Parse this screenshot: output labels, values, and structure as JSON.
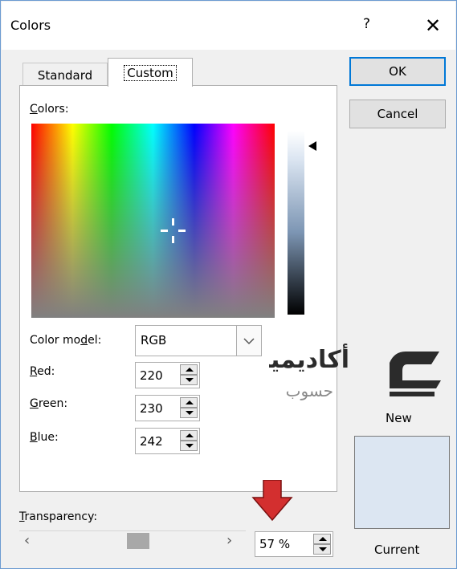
{
  "window": {
    "title": "Colors",
    "help": "?",
    "close": "✕"
  },
  "tabs": {
    "standard": "Standard",
    "custom": "Custom"
  },
  "colors_label": {
    "u": "C",
    "rest": "olors:"
  },
  "color_model": {
    "pre": "Color mo",
    "u": "d",
    "post": "el:",
    "value": "RGB"
  },
  "red": {
    "u": "R",
    "rest": "ed:",
    "value": "220"
  },
  "green": {
    "u": "G",
    "rest": "reen:",
    "value": "230"
  },
  "blue": {
    "u": "B",
    "rest": "lue:",
    "value": "242"
  },
  "transparency": {
    "u": "T",
    "rest": "ransparency:",
    "value": "57 %",
    "level": 0.57
  },
  "buttons": {
    "ok": "OK",
    "cancel": "Cancel"
  },
  "preview": {
    "new_label": "New",
    "current_label": "Current",
    "color": "#dce6f2"
  },
  "watermark": {
    "line1": "أكاديمية",
    "line2": "حسوب"
  },
  "accent": {
    "focus_border": "#0078d7",
    "annotation_arrow": "#d32f2f"
  }
}
